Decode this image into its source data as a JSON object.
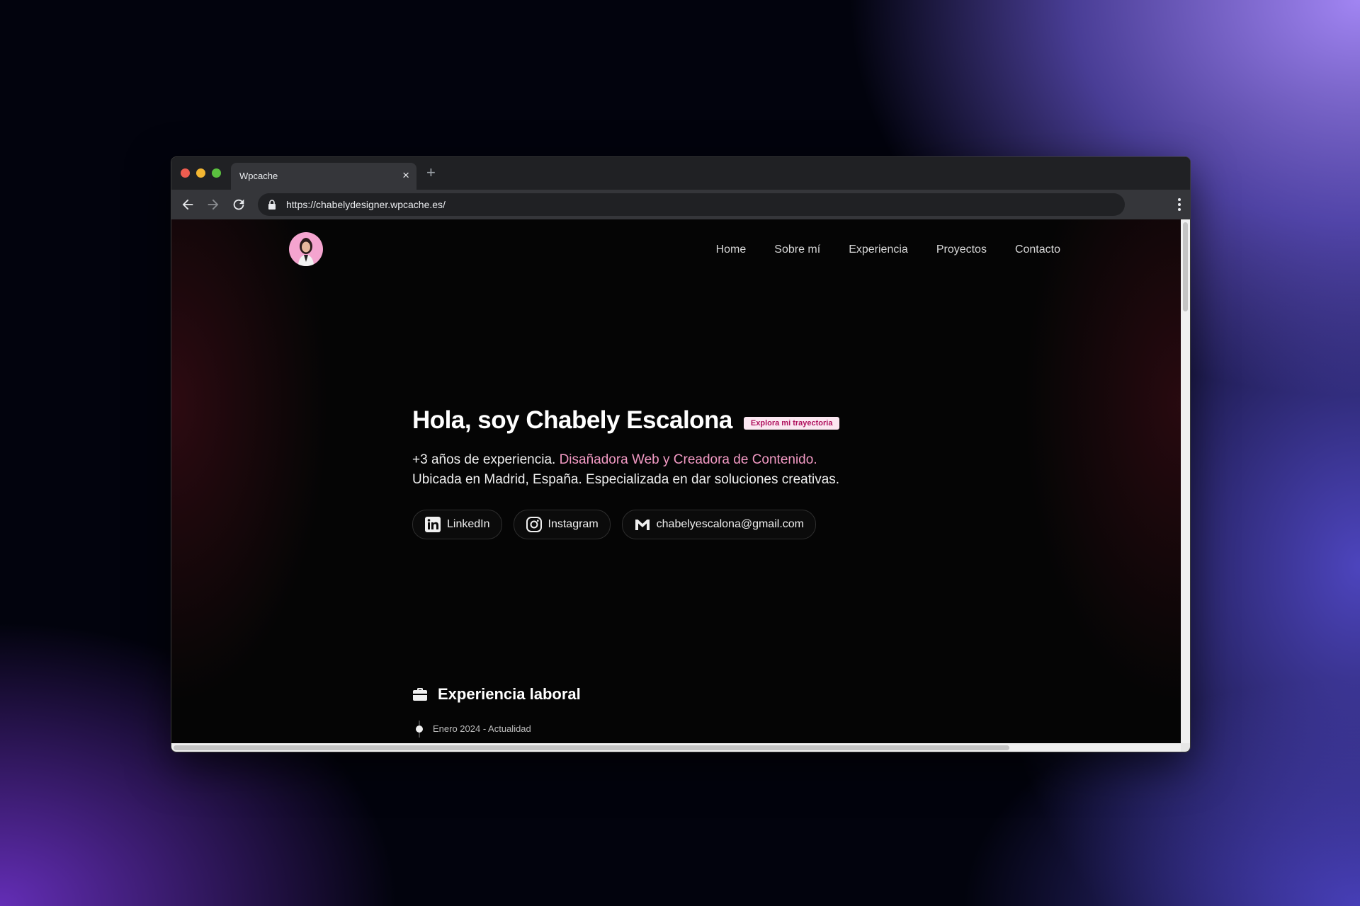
{
  "browser": {
    "tab_title": "Wpcache",
    "tab_close": "×",
    "new_tab": "+",
    "url": "https://chabelydesigner.wpcache.es/"
  },
  "nav": {
    "items": [
      "Home",
      "Sobre mí",
      "Experiencia",
      "Proyectos",
      "Contacto"
    ]
  },
  "hero": {
    "title": "Hola, soy Chabely Escalona",
    "badge": "Explora mi trayectoria",
    "desc_prefix": "+3 años de experiencia. ",
    "desc_accent": "Disañadora Web y Creadora de Contenido.",
    "desc_rest": " Ubicada en Madrid, España. Especializada en dar soluciones creativas.",
    "links": {
      "linkedin": "LinkedIn",
      "instagram": "Instagram",
      "email": "chabelyescalona@gmail.com"
    }
  },
  "experience": {
    "title": "Experiencia laboral",
    "first_date": "Enero 2024 - Actualidad"
  },
  "colors": {
    "accent": "#f39ac4",
    "badge_bg": "#fbe7f1",
    "badge_text": "#b0125f"
  }
}
